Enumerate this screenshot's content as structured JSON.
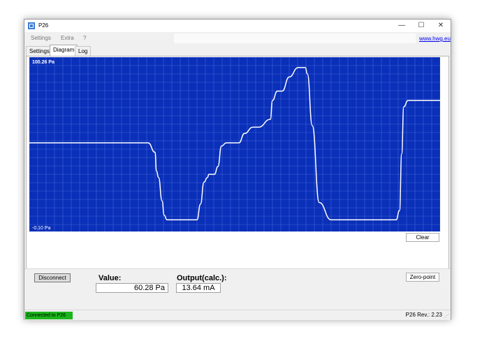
{
  "window": {
    "title": "P26",
    "minimize_glyph": "—",
    "maximize_glyph": "☐",
    "close_glyph": "✕",
    "icon": "app-icon"
  },
  "menu": {
    "items": [
      "Settings",
      "Extra",
      "?"
    ],
    "link": "www.hwg.eu"
  },
  "tabs": [
    "Settings",
    "Diagram",
    "Log"
  ],
  "active_tab": "Diagram",
  "chart_data": {
    "type": "line",
    "ymax_label": "100.26 Pa",
    "ymin_label": "-0.10 Pa",
    "ylim": [
      -0.1,
      100.26
    ],
    "background": "#0a2fb8",
    "line_color": "#ffffff",
    "grid": true,
    "x": [
      0,
      30,
      60,
      90,
      120,
      150,
      170,
      180,
      182,
      185,
      190,
      193,
      197,
      210,
      240,
      245,
      250,
      255,
      257,
      265,
      270,
      275,
      282,
      290,
      300,
      308,
      320,
      328,
      345,
      348,
      355,
      362,
      372,
      385,
      390,
      395,
      398,
      405,
      415,
      432,
      440,
      470,
      500,
      525,
      530,
      533,
      536,
      542,
      560,
      588
    ],
    "values": [
      51,
      51,
      51,
      51,
      51,
      51,
      51,
      45,
      33,
      29,
      14,
      5,
      2,
      2,
      2,
      12,
      26,
      29,
      31,
      31,
      36,
      49,
      51,
      51,
      51,
      57,
      61,
      61,
      66,
      78,
      84,
      84,
      93,
      99,
      99,
      99,
      95,
      62,
      13,
      2,
      2,
      2,
      2,
      2,
      8,
      44,
      74,
      78,
      78,
      78
    ]
  },
  "buttons": {
    "clear": "Clear",
    "disconnect": "Disconnect",
    "zero_point": "Zero-point"
  },
  "readout": {
    "value_label": "Value:",
    "value": "60.28 Pa",
    "output_label": "Output(calc.):",
    "output": "13.64 mA"
  },
  "status": {
    "connection": "Connected to P26",
    "connection_color": "#1bb51b",
    "revision": "P26 Rev.: 2.23",
    "grip_glyph": "⋰"
  }
}
